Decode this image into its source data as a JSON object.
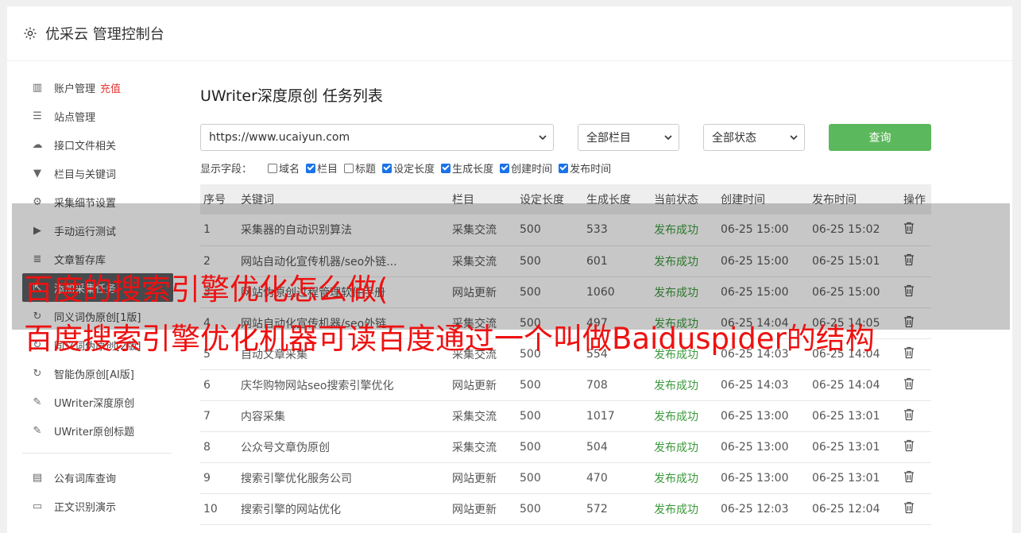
{
  "header": {
    "title": "优采云 管理控制台",
    "icon": "gear-icon"
  },
  "sidebar": {
    "items": [
      {
        "label": "账户管理",
        "badge": "充值",
        "icon": "bar-chart-icon"
      },
      {
        "label": "站点管理",
        "icon": "server-icon"
      },
      {
        "label": "接口文件相关",
        "icon": "cloud-upload-icon"
      },
      {
        "label": "栏目与关键词",
        "icon": "filter-icon"
      },
      {
        "label": "采集细节设置",
        "icon": "gears-icon"
      },
      {
        "label": "手动运行测试",
        "icon": "play-icon"
      },
      {
        "label": "文章暂存库",
        "icon": "database-icon"
      },
      {
        "label": "添加采集任务",
        "icon": "external-link-icon"
      },
      {
        "label": "同义词伪原创[1版]",
        "icon": "refresh-icon"
      },
      {
        "label": "同义词伪原创[2版]",
        "icon": "refresh-icon"
      },
      {
        "label": "智能伪原创[AI版]",
        "icon": "refresh-icon"
      },
      {
        "label": "UWriter深度原创",
        "icon": "edit-icon"
      },
      {
        "label": "UWriter原创标题",
        "icon": "edit-icon"
      }
    ],
    "items2": [
      {
        "label": "公有词库查询",
        "icon": "book-icon"
      },
      {
        "label": "正文识别演示",
        "icon": "monitor-icon"
      }
    ]
  },
  "main": {
    "title": "UWriter深度原创 任务列表",
    "filters": {
      "site": "https://www.ucaiyun.com",
      "column": "全部栏目",
      "status": "全部状态",
      "query_label": "查询"
    },
    "fields": {
      "label": "显示字段：",
      "options": [
        {
          "label": "域名",
          "checked": false
        },
        {
          "label": "栏目",
          "checked": true
        },
        {
          "label": "标题",
          "checked": false
        },
        {
          "label": "设定长度",
          "checked": true
        },
        {
          "label": "生成长度",
          "checked": true
        },
        {
          "label": "创建时间",
          "checked": true
        },
        {
          "label": "发布时间",
          "checked": true
        }
      ]
    },
    "table": {
      "headers": [
        "序号",
        "关键词",
        "栏目",
        "设定长度",
        "生成长度",
        "当前状态",
        "创建时间",
        "发布时间",
        "操作"
      ],
      "rows": [
        [
          "1",
          "采集器的自动识别算法",
          "采集交流",
          "500",
          "533",
          "发布成功",
          "06-25 15:00",
          "06-25 15:02"
        ],
        [
          "2",
          "网站自动化宣传机器/seo外链...",
          "采集交流",
          "500",
          "601",
          "发布成功",
          "06-25 15:00",
          "06-25 15:01"
        ],
        [
          "3",
          "网站伪原创过程管理软件手册",
          "网站更新",
          "500",
          "1060",
          "发布成功",
          "06-25 15:00",
          "06-25 15:00"
        ],
        [
          "4",
          "网站自动化宣传机器/seo外链...",
          "采集交流",
          "500",
          "497",
          "发布成功",
          "06-25 14:04",
          "06-25 14:05"
        ],
        [
          "5",
          "自动文章采集",
          "采集交流",
          "500",
          "554",
          "发布成功",
          "06-25 14:03",
          "06-25 14:04"
        ],
        [
          "6",
          "庆华购物网站seo搜索引擎优化",
          "网站更新",
          "500",
          "708",
          "发布成功",
          "06-25 14:03",
          "06-25 14:04"
        ],
        [
          "7",
          "内容采集",
          "采集交流",
          "500",
          "1017",
          "发布成功",
          "06-25 13:00",
          "06-25 13:01"
        ],
        [
          "8",
          "公众号文章伪原创",
          "采集交流",
          "500",
          "504",
          "发布成功",
          "06-25 13:00",
          "06-25 13:01"
        ],
        [
          "9",
          "搜索引擎优化服务公司",
          "网站更新",
          "500",
          "470",
          "发布成功",
          "06-25 13:00",
          "06-25 13:01"
        ],
        [
          "10",
          "搜索引擎的网站优化",
          "网站更新",
          "500",
          "572",
          "发布成功",
          "06-25 12:03",
          "06-25 12:04"
        ]
      ]
    }
  },
  "overlay": {
    "line1": "百度的搜索引擎优化怎么做(",
    "line2": "百度搜索引擎优化机器可读百度通过一个叫做Baiduspider的结构"
  },
  "colors": {
    "accent": "#5cb85c",
    "danger": "#e53935",
    "overlay_text": "#ee1111",
    "success": "#3c9a3c"
  }
}
